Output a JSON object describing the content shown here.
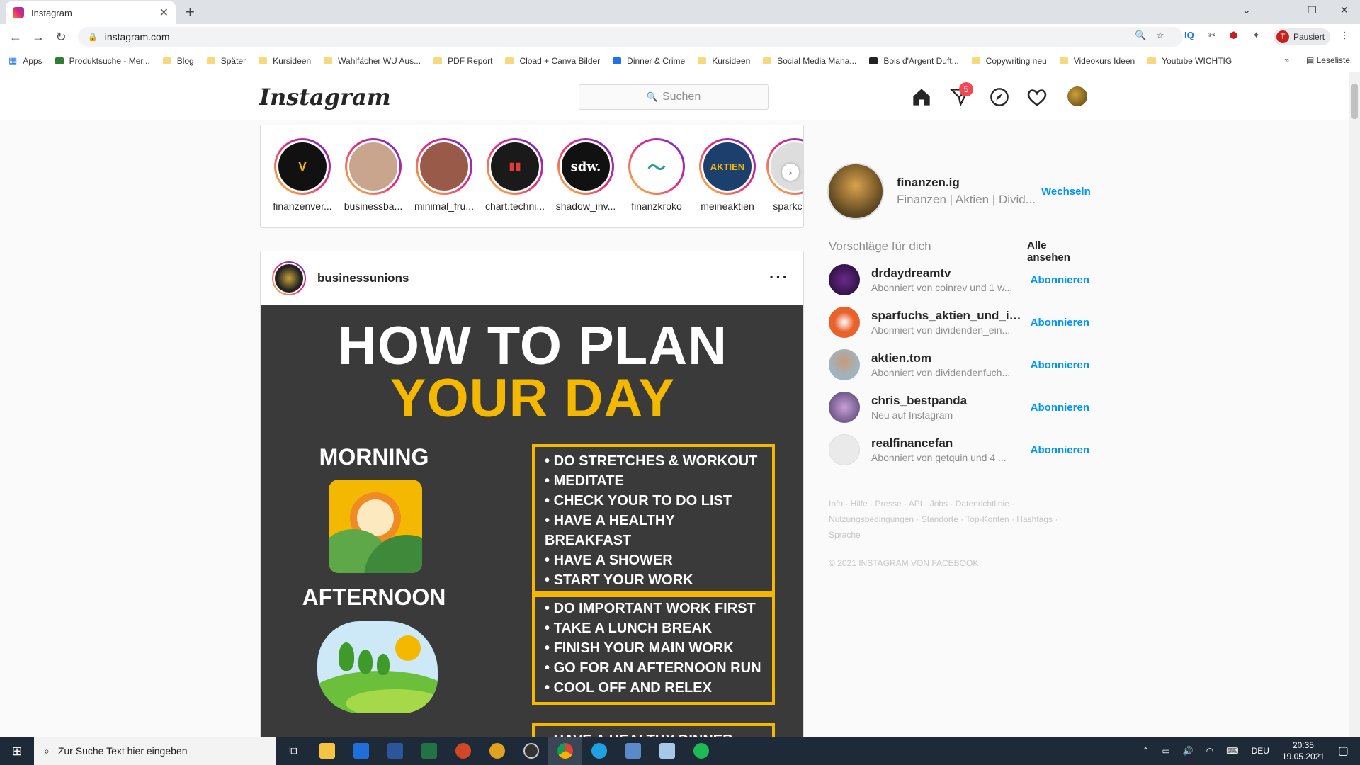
{
  "browser": {
    "tab_title": "Instagram",
    "url": "instagram.com",
    "profile_label": "Pausiert",
    "profile_initial": "T",
    "ext_iq": "IQ",
    "bookmarks": [
      "Apps",
      "Produktsuche - Mer...",
      "Blog",
      "Später",
      "Kursideen",
      "Wahlfächer WU Aus...",
      "PDF Report",
      "Cload + Canva Bilder",
      "Dinner & Crime",
      "Kursideen",
      "Social Media Mana...",
      "Bois d'Argent Duft...",
      "Copywriting neu",
      "Videokurs Ideen",
      "Youtube WICHTIG"
    ],
    "reading_list": "Leseliste"
  },
  "header": {
    "logo": "Instagram",
    "search_placeholder": "Suchen",
    "dm_badge": "5"
  },
  "stories": [
    {
      "name": "finanzenver...",
      "initial": "V",
      "bg": "#111111"
    },
    {
      "name": "businessba...",
      "initial": "",
      "bg": "#c8a58c"
    },
    {
      "name": "minimal_fru...",
      "initial": "",
      "bg": "#9a5a4a"
    },
    {
      "name": "chart.techni...",
      "initial": "▮▮",
      "bg": "#1a1a1a"
    },
    {
      "name": "shadow_inv...",
      "initial": "sdw.",
      "bg": "#111111"
    },
    {
      "name": "finanzkroko",
      "initial": "〜",
      "bg": "#ffffff"
    },
    {
      "name": "meineaktien",
      "initial": "AKTIEN",
      "bg": "#1c3f6e"
    },
    {
      "name": "sparkc",
      "initial": "",
      "bg": "#dddddd"
    }
  ],
  "post": {
    "username": "businessunions",
    "title_line1": "HOW TO PLAN",
    "title_line2": "YOUR DAY",
    "morning_label": "MORNING",
    "afternoon_label": "AFTERNOON",
    "morning_items": [
      "DO STRETCHES & WORKOUT",
      "MEDITATE",
      "CHECK YOUR TO DO LIST",
      "HAVE A HEALTHY BREAKFAST",
      "HAVE A SHOWER",
      "START YOUR WORK"
    ],
    "afternoon_items": [
      "DO IMPORTANT WORK FIRST",
      "TAKE A LUNCH BREAK",
      "FINISH YOUR MAIN WORK",
      "GO FOR AN AFTERNOON RUN",
      "COOL OFF AND RELEX"
    ],
    "evening_items": [
      "HAVE A HEALTHY DINNER"
    ]
  },
  "sidebar": {
    "username": "finanzen.ig",
    "subtitle": "Finanzen | Aktien | Divid...",
    "switch_label": "Wechseln",
    "suggestions_title": "Vorschläge für dich",
    "see_all": "Alle ansehen",
    "suggestions": [
      {
        "user": "drdaydreamtv",
        "sub": "Abonniert von coinrev und 1 w...",
        "action": "Abonnieren",
        "color": "#3a1a4a"
      },
      {
        "user": "sparfuchs_aktien_und_inv...",
        "sub": "Abonniert von dividenden_ein...",
        "action": "Abonnieren",
        "color": "#e8622c"
      },
      {
        "user": "aktien.tom",
        "sub": "Abonniert von dividendenfuch...",
        "action": "Abonnieren",
        "color": "#a0b4c0"
      },
      {
        "user": "chris_bestpanda",
        "sub": "Neu auf Instagram",
        "action": "Abonnieren",
        "color": "#6a5a8a"
      },
      {
        "user": "realfinancefan",
        "sub": "Abonniert von getquin und 4 ...",
        "action": "Abonnieren",
        "color": "#eaeaea"
      }
    ],
    "footer_links": "Info · Hilfe · Presse · API · Jobs · Datenrichtlinie · Nutzungsbedingungen · Standorte · Top-Konten · Hashtags · Sprache",
    "copyright": "© 2021 INSTAGRAM VON FACEBOOK"
  },
  "taskbar": {
    "search_placeholder": "Zur Suche Text hier eingeben",
    "lang": "DEU",
    "time": "20:35",
    "date": "19.05.2021"
  }
}
